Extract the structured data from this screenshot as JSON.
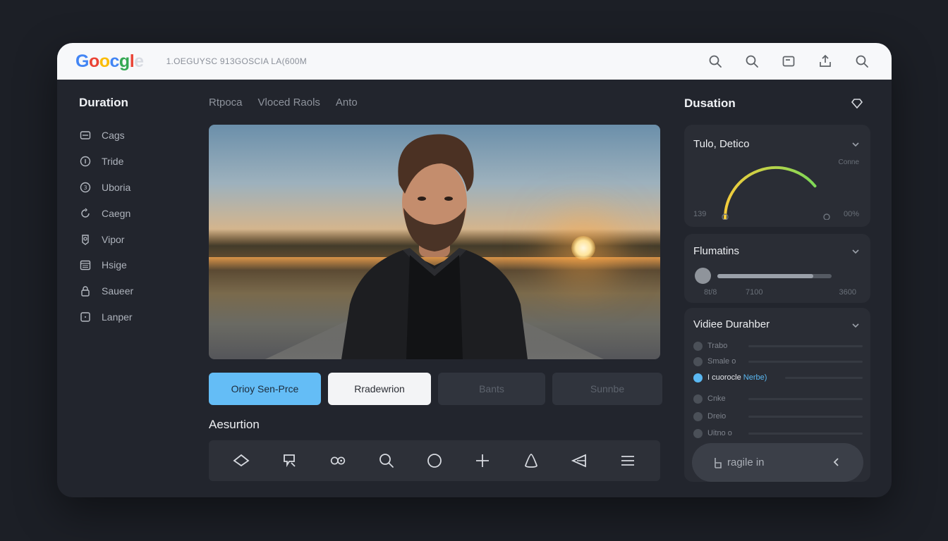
{
  "browser": {
    "logo_letters": [
      "G",
      "o",
      "o",
      "c",
      "g",
      "l",
      "e"
    ],
    "url": "1.OEGUYSC 913GOSCIA LA(600M"
  },
  "sidebar": {
    "title": "Duration",
    "items": [
      {
        "label": "Cags",
        "icon": "card-icon"
      },
      {
        "label": "Tride",
        "icon": "info-icon"
      },
      {
        "label": "Uboria",
        "icon": "coin-icon"
      },
      {
        "label": "Caegn",
        "icon": "refresh-icon"
      },
      {
        "label": "Vipor",
        "icon": "badge-icon"
      },
      {
        "label": "Hsige",
        "icon": "calendar-icon"
      },
      {
        "label": "Saueer",
        "icon": "lock-icon"
      },
      {
        "label": "Lanper",
        "icon": "square-icon"
      }
    ]
  },
  "tabs": [
    "Rtpoca",
    "Vloced Raols",
    "Anto"
  ],
  "actions": {
    "primary": "Orioy Sen-Prce",
    "secondary": "Rradewrion",
    "disabled1": "Bants",
    "disabled2": "Sunnbe"
  },
  "section": {
    "title": "Aesurtion",
    "tools": [
      "diamond-icon",
      "tag-icon",
      "link-icon",
      "search-icon",
      "circle-icon",
      "plus-icon",
      "triangle-icon",
      "send-icon",
      "menu-icon"
    ]
  },
  "right_panel": {
    "title": "Dusation",
    "gauge_card": {
      "title": "Tulo, Detico",
      "unit_label": "Conne",
      "min_label": "139",
      "max_label": "00%",
      "level": 0.78,
      "colors": {
        "start": "#f4cc3c",
        "end": "#7ed957"
      }
    },
    "slider_card": {
      "title": "Flumatins",
      "left_label": "8t/8",
      "mid_label": "7100",
      "right_label": "3600",
      "fill": 0.84
    },
    "duration_card": {
      "title": "Vidiee Durahber",
      "rows": [
        {
          "label": "Trabo",
          "active": false
        },
        {
          "label": "Smale o",
          "active": false
        },
        {
          "label": "I cuorocle",
          "extra": "Nerbe)",
          "active": true
        },
        {
          "label": "Cnke",
          "active": false
        },
        {
          "label": "Dreio",
          "active": false
        },
        {
          "label": "Uitno o",
          "active": false
        }
      ],
      "pill_label": "ragile in"
    }
  },
  "accent_color": "#64bdf6"
}
